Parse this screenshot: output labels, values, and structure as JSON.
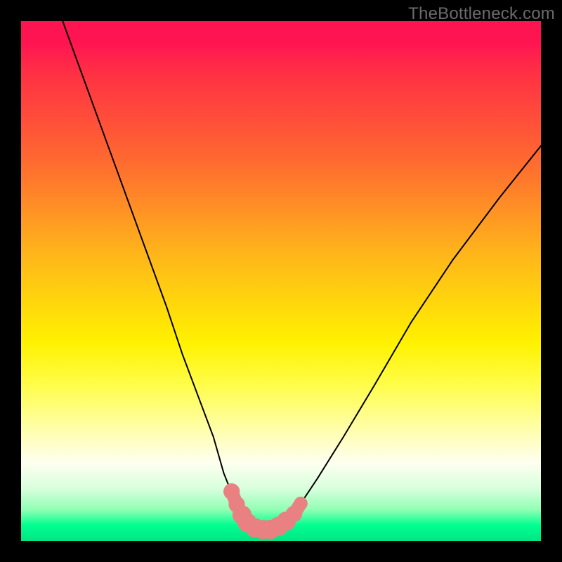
{
  "watermark": "TheBottleneck.com",
  "chart_data": {
    "type": "line",
    "title": "",
    "xlabel": "",
    "ylabel": "",
    "xlim": [
      0,
      100
    ],
    "ylim": [
      0,
      100
    ],
    "series": [
      {
        "name": "bottleneck-curve",
        "x": [
          8,
          12,
          16,
          20,
          24,
          28,
          31,
          34,
          37,
          39,
          41,
          42.5,
          44,
          46,
          48,
          50,
          53,
          57,
          62,
          68,
          75,
          83,
          92,
          100
        ],
        "values": [
          100,
          89,
          78,
          67,
          56,
          45,
          36,
          28,
          20,
          13,
          8,
          5,
          3,
          2,
          2,
          3,
          6,
          12,
          20,
          30,
          42,
          54,
          66,
          76
        ]
      }
    ],
    "markers": {
      "name": "highlight-points",
      "color": "#e98183",
      "points": [
        {
          "x": 40.5,
          "y": 9.5,
          "r": 1.3
        },
        {
          "x": 41.5,
          "y": 7.0,
          "r": 1.3
        },
        {
          "x": 42.5,
          "y": 5.0,
          "r": 1.6
        },
        {
          "x": 43.5,
          "y": 3.5,
          "r": 1.6
        },
        {
          "x": 45.0,
          "y": 2.5,
          "r": 1.6
        },
        {
          "x": 46.5,
          "y": 2.2,
          "r": 1.6
        },
        {
          "x": 48.0,
          "y": 2.2,
          "r": 1.6
        },
        {
          "x": 49.5,
          "y": 2.8,
          "r": 1.6
        },
        {
          "x": 51.0,
          "y": 3.8,
          "r": 1.6
        },
        {
          "x": 52.5,
          "y": 5.2,
          "r": 1.3
        },
        {
          "x": 53.8,
          "y": 7.2,
          "r": 1.0
        }
      ]
    },
    "background_gradient": [
      {
        "pos": 0,
        "color": "#ff1452"
      },
      {
        "pos": 27,
        "color": "#ff6a30"
      },
      {
        "pos": 45,
        "color": "#ffb61a"
      },
      {
        "pos": 62,
        "color": "#fff200"
      },
      {
        "pos": 85,
        "color": "#fefff0"
      },
      {
        "pos": 100,
        "color": "#00e583"
      }
    ]
  }
}
